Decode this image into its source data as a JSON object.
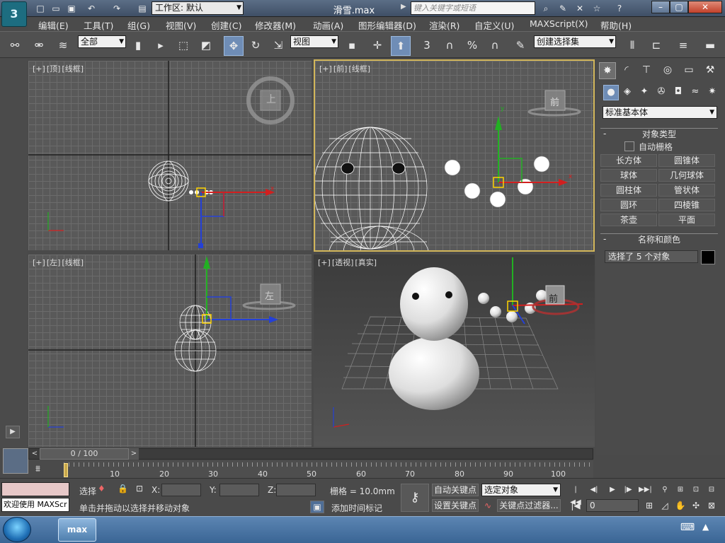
{
  "window": {
    "title": "滑雪.max",
    "workspace_label": "工作区: 默认",
    "search_placeholder": "键入关键字或短语",
    "logo": "3ds max"
  },
  "menu": [
    "编辑(E)",
    "工具(T)",
    "组(G)",
    "视图(V)",
    "创建(C)",
    "修改器(M)",
    "动画(A)",
    "图形编辑器(D)",
    "渲染(R)",
    "自定义(U)",
    "MAXScript(X)",
    "帮助(H)"
  ],
  "toolbar": {
    "selection_filter": "全部",
    "reference_coord": "视图",
    "named_selection": "创建选择集",
    "snap_labels": [
      "3",
      "%"
    ]
  },
  "viewports": {
    "top": {
      "label": [
        "[+]",
        "[顶]",
        "[线框]"
      ],
      "viewcube": "上"
    },
    "front": {
      "label": [
        "[+]",
        "[前]",
        "[线框]"
      ],
      "viewcube": "前"
    },
    "left": {
      "label": [
        "[+]",
        "[左]",
        "[线框]"
      ],
      "viewcube": "左"
    },
    "perspective": {
      "label": [
        "[+]",
        "[透视]",
        "[真实]"
      ],
      "viewcube": "前"
    }
  },
  "command_panel": {
    "category": "标准基本体",
    "object_type_title": "对象类型",
    "auto_grid": "自动栅格",
    "buttons": [
      "长方体",
      "圆锥体",
      "球体",
      "几何球体",
      "圆柱体",
      "管状体",
      "圆环",
      "四棱锥",
      "茶壶",
      "平面"
    ],
    "name_color_title": "名称和颜色",
    "name_value": "选择了 5 个对象",
    "color": "#000000"
  },
  "timeline": {
    "frame_display": "0 / 100",
    "ticks": [
      "10",
      "20",
      "30",
      "40",
      "50",
      "60",
      "70",
      "80",
      "90",
      "100"
    ]
  },
  "status": {
    "maxscript_welcome": "欢迎使用 MAXScr",
    "selection_label": "选择",
    "x_label": "X:",
    "y_label": "Y:",
    "z_label": "Z:",
    "grid": "栅格 = 10.0mm",
    "prompt": "单击并拖动以选择并移动对象",
    "add_time_tag": "添加时间标记",
    "auto_key": "自动关键点",
    "set_key": "设置关键点",
    "key_mode": "选定对象",
    "key_filters": "关键点过滤器...",
    "current_frame": "0"
  },
  "colors": {
    "active_border": "#d2b65a",
    "axis_x": "#d21f1f",
    "axis_y": "#22b022",
    "axis_z": "#2440d6",
    "selection_box": "#ffd400"
  }
}
